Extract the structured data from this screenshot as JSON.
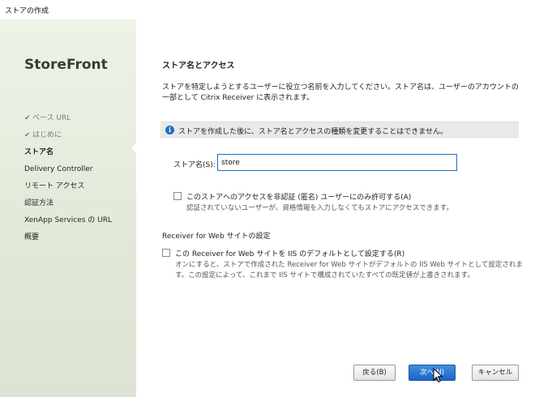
{
  "window": {
    "title": "ストアの作成"
  },
  "sidebar": {
    "brand": "StoreFront",
    "steps": [
      {
        "label": "ベース URL",
        "state": "done"
      },
      {
        "label": "はじめに",
        "state": "done"
      },
      {
        "label": "ストア名",
        "state": "current"
      },
      {
        "label": "Delivery Controller",
        "state": "pending"
      },
      {
        "label": "リモート アクセス",
        "state": "pending"
      },
      {
        "label": "認証方法",
        "state": "pending"
      },
      {
        "label": "XenApp Services の URL",
        "state": "pending"
      },
      {
        "label": "概要",
        "state": "pending"
      }
    ],
    "check_icon": "check-icon"
  },
  "main": {
    "heading": "ストア名とアクセス",
    "description": "ストアを特定しようとするユーザーに役立つ名前を入力してください。ストア名は、ユーザーのアカウントの一部として Citrix Receiver に表示されます。",
    "info": {
      "icon": "info-icon",
      "text": "ストアを作成した後に、ストア名とアクセスの種類を変更することはできません。"
    },
    "store_name": {
      "label": "ストア名(S):",
      "value": "store"
    },
    "unauth_option": {
      "label": "このストアへのアクセスを非認証 (匿名) ユーザーにのみ許可する(A)",
      "help": "認証されていないユーザーが、資格情報を入力しなくてもストアにアクセスできます。",
      "checked": false
    },
    "receiver_section": {
      "heading": "Receiver for Web サイトの設定",
      "default_option": {
        "label": "この Receiver for Web サイトを IIS のデフォルトとして設定する(R)",
        "help": "オンにすると、ストアで作成された Receiver for Web サイトがデフォルトの IIS Web サイトとして設定されます。この設定によって、これまで IIS サイトで構成されていたすべての既定値が上書きされます。",
        "checked": false
      }
    }
  },
  "footer": {
    "back_label": "戻る(B)",
    "next_label": "次へ(N)",
    "cancel_label": "キャンセル"
  },
  "colors": {
    "accent": "#1e6fc4",
    "sidebar_bg": "#e6ecdc",
    "info_bg": "#e9e9e9"
  }
}
